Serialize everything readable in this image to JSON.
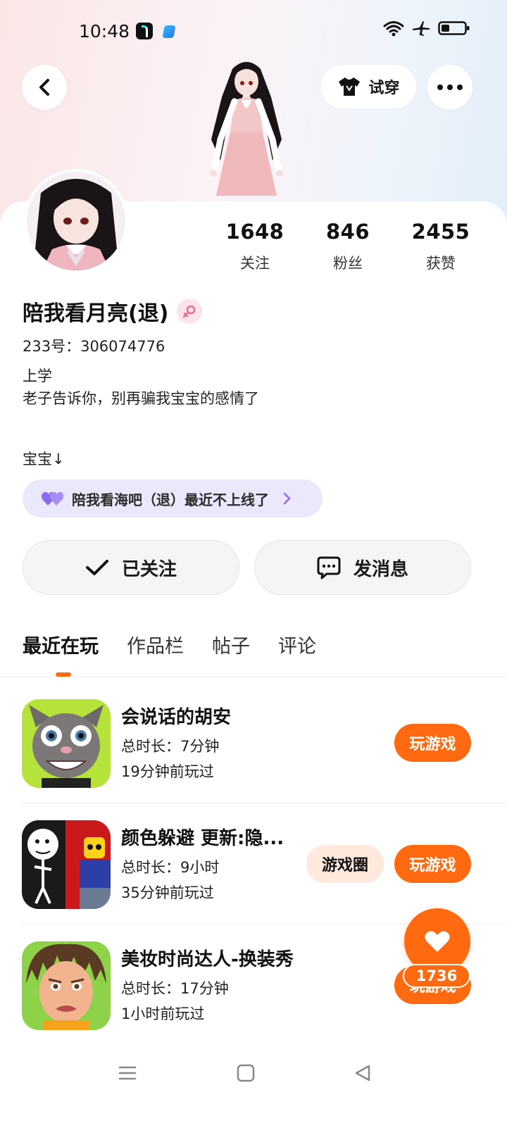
{
  "status_bar": {
    "time": "10:48",
    "icons": [
      "tiktok-lite-icon",
      "blue-app-icon",
      "wifi-icon",
      "airplane-icon",
      "battery-icon"
    ]
  },
  "header": {
    "try_on_label": "试穿"
  },
  "profile": {
    "nickname": "陪我看月亮(退)",
    "uid": "233号：306074776",
    "bio_lines": [
      "上学",
      "老子告诉你，别再骗我宝宝的感情了"
    ],
    "bio_extra": "宝宝↓",
    "gender": "female"
  },
  "stats": [
    {
      "value": "1648",
      "label": "关注"
    },
    {
      "value": "846",
      "label": "粉丝"
    },
    {
      "value": "2455",
      "label": "获赞"
    }
  ],
  "cp_bar": {
    "text": "陪我看海吧（退）最近不上线了"
  },
  "actions": {
    "follow_label": "已关注",
    "message_label": "发消息"
  },
  "tabs": [
    {
      "label": "最近在玩",
      "active": true
    },
    {
      "label": "作品栏",
      "active": false
    },
    {
      "label": "帖子",
      "active": false
    },
    {
      "label": "评论",
      "active": false
    }
  ],
  "games": [
    {
      "title": "会说话的胡安",
      "duration": "总时长：7分钟",
      "last_played": "19分钟前玩过",
      "play_label": "玩游戏",
      "circle_label": ""
    },
    {
      "title": "颜色躲避 更新:隐...",
      "duration": "总时长：9小时",
      "last_played": "35分钟前玩过",
      "play_label": "玩游戏",
      "circle_label": "游戏圈"
    },
    {
      "title": "美妆时尚达人-换装秀",
      "duration": "总时长：17分钟",
      "last_played": "1小时前玩过",
      "play_label": "玩游戏",
      "circle_label": ""
    }
  ],
  "like": {
    "count": "1736"
  },
  "colors": {
    "accent": "#ff6a10",
    "cp_bar_bg": "#ebe8fb",
    "circle_btn_bg": "#ffe8dc"
  }
}
